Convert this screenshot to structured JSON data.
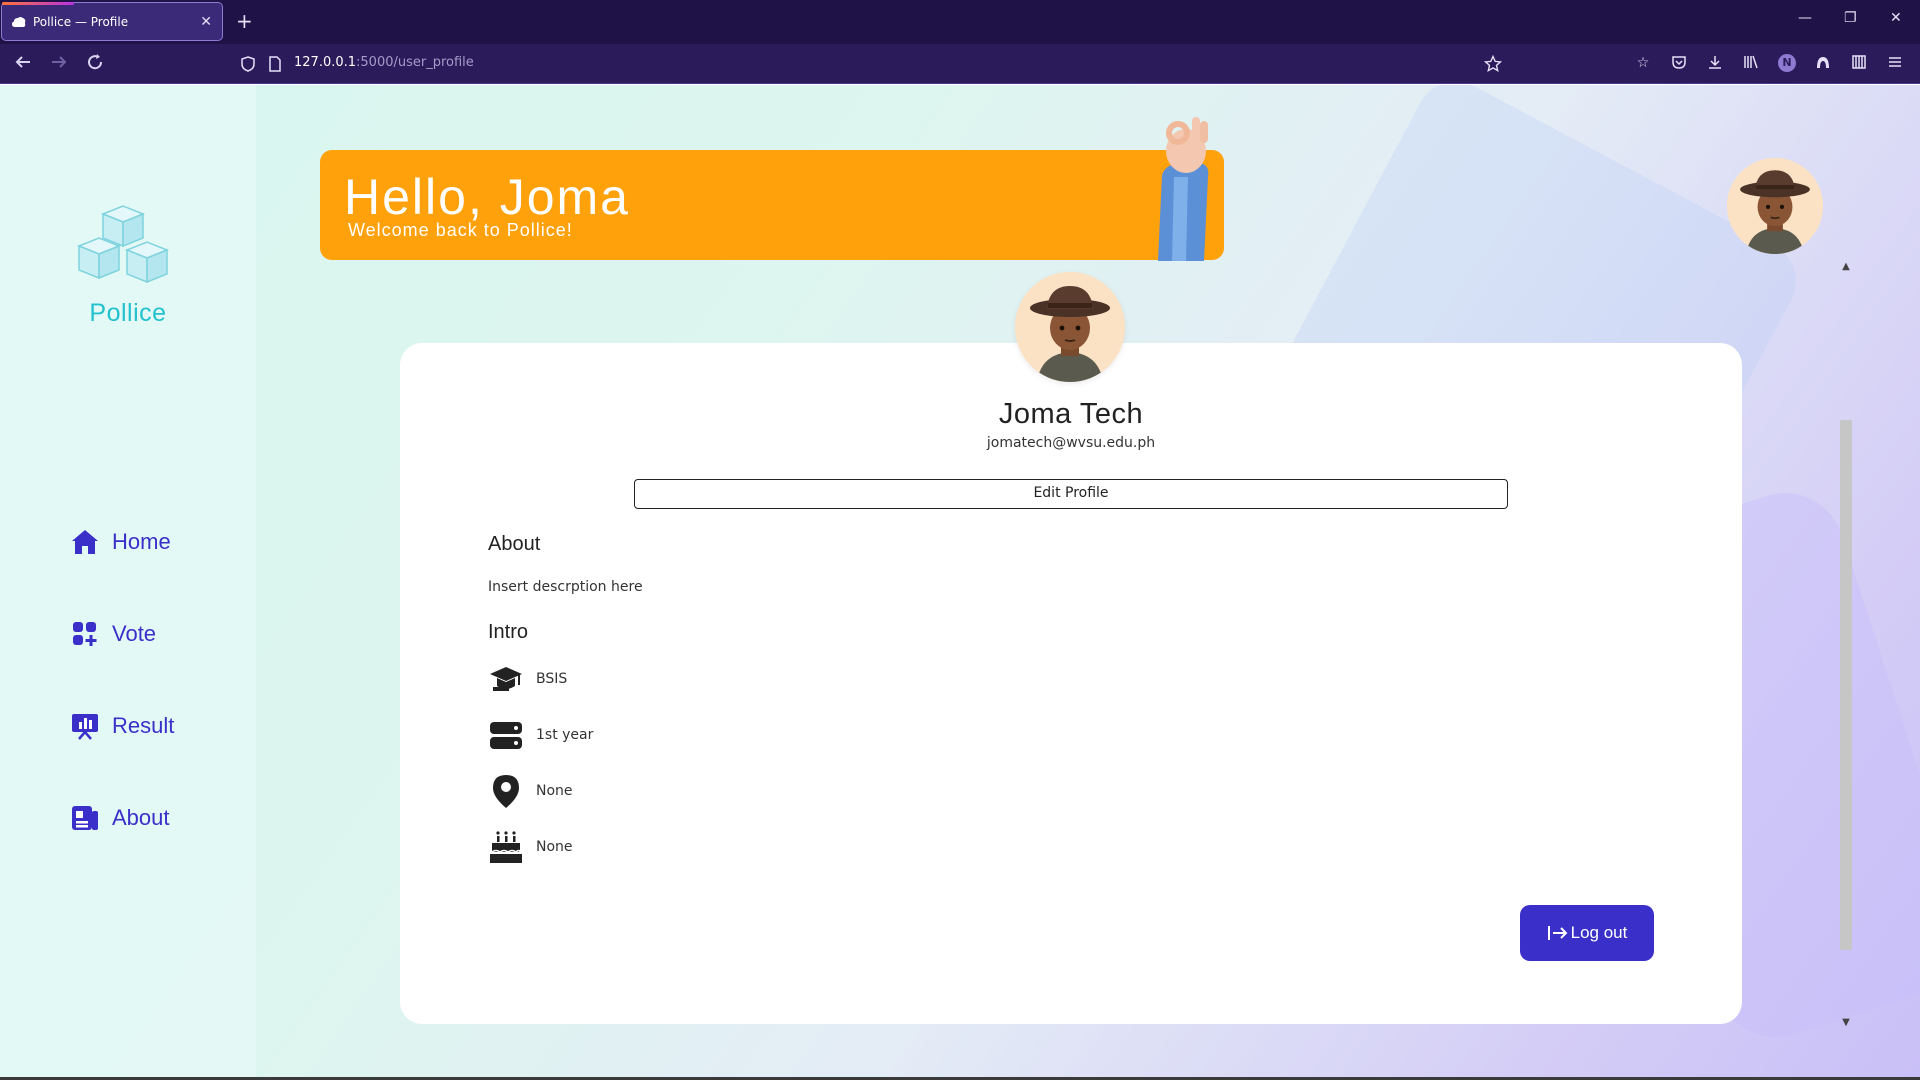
{
  "browser": {
    "tab_title": "Pollice — Profile",
    "tab_close": "✕",
    "new_tab": "+",
    "url_host": "127.0.0.1",
    "url_rest": ":5000/user_profile",
    "win_min": "—",
    "win_restore": "❐",
    "win_close": "✕",
    "profile_initial": "N"
  },
  "sidebar": {
    "brand": "Pollice",
    "items": [
      {
        "label": "Home",
        "icon": "home-icon"
      },
      {
        "label": "Vote",
        "icon": "vote-icon"
      },
      {
        "label": "Result",
        "icon": "result-icon"
      },
      {
        "label": "About",
        "icon": "about-icon"
      }
    ]
  },
  "banner": {
    "title": "Hello, Joma",
    "subtitle": "Welcome back to Pollice!"
  },
  "profile": {
    "name": "Joma Tech",
    "email": "jomatech@wvsu.edu.ph",
    "edit_label": "Edit Profile",
    "about_heading": "About",
    "about_text": "Insert descrption here",
    "intro_heading": "Intro",
    "intro": [
      {
        "icon": "graduation-cap-icon",
        "value": "BSIS"
      },
      {
        "icon": "server-icon",
        "value": "1st year"
      },
      {
        "icon": "location-pin-icon",
        "value": "None"
      },
      {
        "icon": "birthday-cake-icon",
        "value": "None"
      }
    ],
    "logout_label": "Log out"
  },
  "colors": {
    "accent": "#3b2fc9",
    "banner": "#ffa10b",
    "brand": "#24c1cf"
  }
}
